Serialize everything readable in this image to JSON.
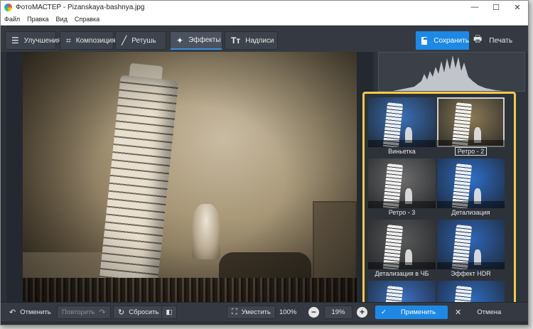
{
  "window": {
    "title": "ФотоМАСТЕР - Pizanskaya-bashnya.jpg"
  },
  "menu": [
    "Файл",
    "Правка",
    "Вид",
    "Справка"
  ],
  "tabs": [
    {
      "label": "Улучшения",
      "icon": "sliders-icon"
    },
    {
      "label": "Композиция",
      "icon": "crop-icon"
    },
    {
      "label": "Ретушь",
      "icon": "brush-icon"
    },
    {
      "label": "Эффекты",
      "icon": "magic-wand-icon"
    },
    {
      "label": "Надписи",
      "icon": "text-icon"
    }
  ],
  "active_tab": "Эффекты",
  "actions": {
    "save": "Сохранить",
    "print": "Печать"
  },
  "effects": [
    {
      "label": "Виньетка",
      "tint": "#3b6fb4"
    },
    {
      "label": "Ретро - 2",
      "tint": "#8c7a55",
      "selected": true
    },
    {
      "label": "Ретро - 3",
      "tint": "#6d6d6d"
    },
    {
      "label": "Детализация",
      "tint": "#2f6fc9"
    },
    {
      "label": "Детализация в ЧБ",
      "tint": "#5a5a5a"
    },
    {
      "label": "Эффект HDR",
      "tint": "#2f66b8"
    },
    {
      "label": "",
      "tint": "#3a70c4"
    },
    {
      "label": "",
      "tint": "#2f6cc0"
    }
  ],
  "bottom": {
    "undo": "Отменить",
    "redo": "Повторить",
    "reset": "Сбросить",
    "fit": "Уместить",
    "zoom_100": "100%",
    "zoom_value": "19%",
    "apply": "Применить",
    "cancel": "Отмена"
  },
  "colors": {
    "accent": "#1e88e5",
    "highlight": "#f2c94c",
    "panel": "#2b2f36"
  }
}
